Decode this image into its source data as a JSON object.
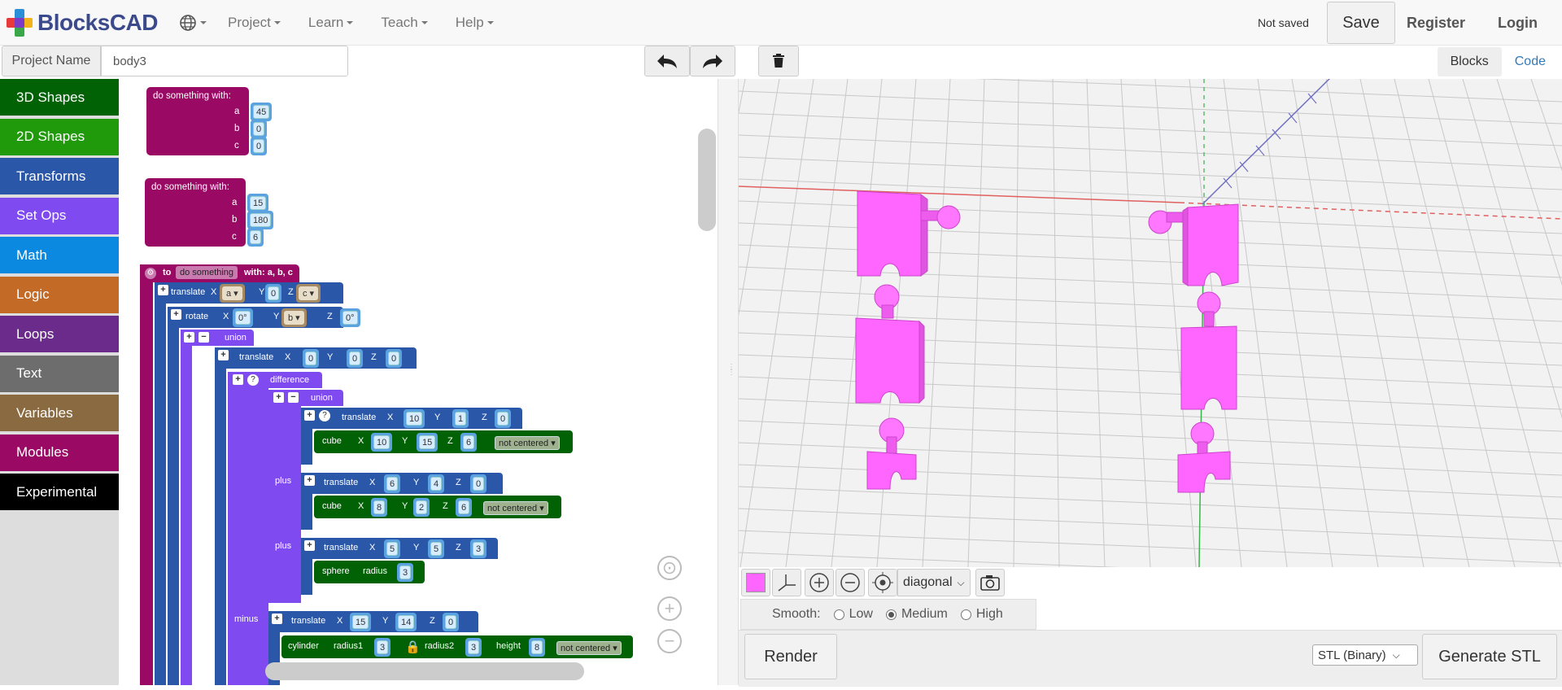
{
  "app": {
    "brand": "BlocksCAD",
    "menu": [
      "Project",
      "Learn",
      "Teach",
      "Help"
    ],
    "status": "Not saved",
    "save_label": "Save",
    "register_label": "Register",
    "login_label": "Login"
  },
  "project": {
    "label": "Project Name",
    "name": "body3"
  },
  "view_tabs": {
    "blocks": "Blocks",
    "code": "Code"
  },
  "toolbox": [
    {
      "label": "3D Shapes",
      "color": "#006205"
    },
    {
      "label": "2D Shapes",
      "color": "#209a0b"
    },
    {
      "label": "Transforms",
      "color": "#2a57a8"
    },
    {
      "label": "Set Ops",
      "color": "#7f4bf0"
    },
    {
      "label": "Math",
      "color": "#0b88e0"
    },
    {
      "label": "Logic",
      "color": "#c46a27"
    },
    {
      "label": "Loops",
      "color": "#6a2b8a"
    },
    {
      "label": "Text",
      "color": "#6d6d6d"
    },
    {
      "label": "Variables",
      "color": "#8a6a41"
    },
    {
      "label": "Modules",
      "color": "#9a0a64"
    },
    {
      "label": "Experimental",
      "color": "#000000"
    }
  ],
  "blocks": {
    "call1": {
      "title": "do something  with:",
      "a_label": "a",
      "b_label": "b",
      "c_label": "c",
      "a": "45",
      "b": "0",
      "c": "0"
    },
    "call2": {
      "title": "do something  with:",
      "a_label": "a",
      "b_label": "b",
      "c_label": "c",
      "a": "15",
      "b": "180",
      "c": "6"
    },
    "def": {
      "to": "to",
      "name": "do something",
      "with": "with: a, b, c"
    },
    "translate1": {
      "label": "translate",
      "x": "X",
      "y": "Y",
      "z": "Z",
      "xv": "a",
      "yv": "0",
      "zv": "c"
    },
    "rotate1": {
      "label": "rotate",
      "x": "X",
      "y": "Y",
      "z": "Z",
      "xv": "0°",
      "yv": "b",
      "zv": "0°"
    },
    "union1": {
      "label": "union"
    },
    "translate2": {
      "label": "translate",
      "x": "X",
      "y": "Y",
      "z": "Z",
      "xv": "0",
      "yv": "0",
      "zv": "0"
    },
    "difference": {
      "label": "difference"
    },
    "union2": {
      "label": "union"
    },
    "translate3": {
      "label": "translate",
      "x": "X",
      "y": "Y",
      "z": "Z",
      "xv": "10",
      "yv": "1",
      "zv": "0"
    },
    "cube1": {
      "label": "cube",
      "x": "X",
      "y": "Y",
      "z": "Z",
      "xv": "10",
      "yv": "15",
      "zv": "6",
      "mode": "not centered"
    },
    "plus1": "plus",
    "translate4": {
      "label": "translate",
      "x": "X",
      "y": "Y",
      "z": "Z",
      "xv": "6",
      "yv": "4",
      "zv": "0"
    },
    "cube2": {
      "label": "cube",
      "x": "X",
      "y": "Y",
      "z": "Z",
      "xv": "8",
      "yv": "2",
      "zv": "6",
      "mode": "not centered"
    },
    "plus2": "plus",
    "translate5": {
      "label": "translate",
      "x": "X",
      "y": "Y",
      "z": "Z",
      "xv": "5",
      "yv": "5",
      "zv": "3"
    },
    "sphere": {
      "label": "sphere",
      "radius": "radius",
      "rv": "3"
    },
    "minus": "minus",
    "translate6": {
      "label": "translate",
      "x": "X",
      "y": "Y",
      "z": "Z",
      "xv": "15",
      "yv": "14",
      "zv": "0"
    },
    "cylinder": {
      "label": "cylinder",
      "r1": "radius1",
      "r1v": "3",
      "r2": "radius2",
      "r2v": "3",
      "h": "height",
      "hv": "8",
      "mode": "not centered"
    }
  },
  "viewer": {
    "camera": "diagonal",
    "smooth_label": "Smooth:",
    "smooth_options": [
      "Low",
      "Medium",
      "High"
    ],
    "smooth_selected": "Medium",
    "render_label": "Render",
    "format": "STL (Binary)",
    "generate_label": "Generate STL",
    "shape_color": "#ff66ff"
  }
}
